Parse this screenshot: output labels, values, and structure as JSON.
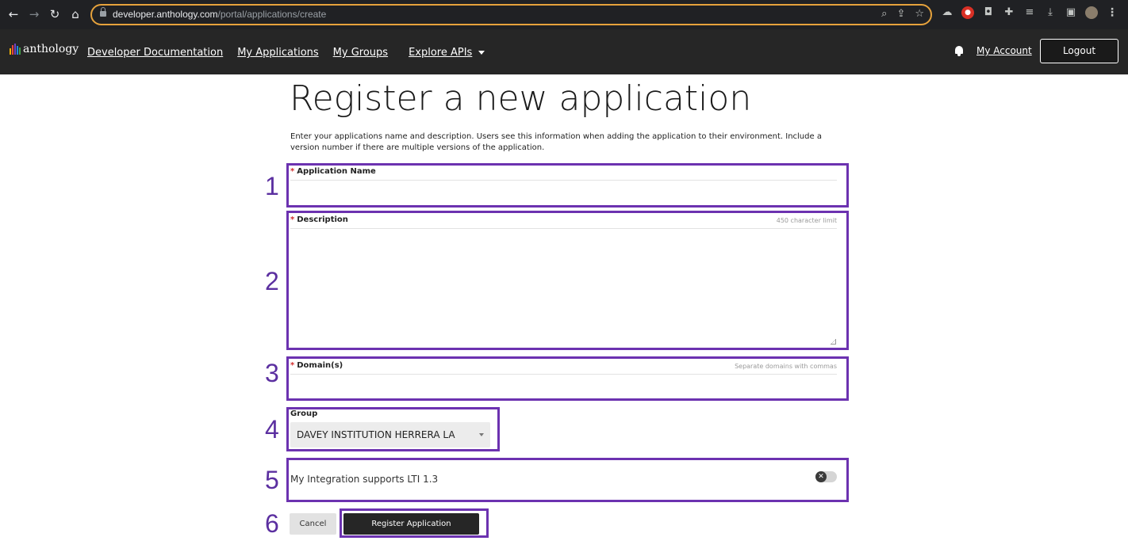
{
  "browser": {
    "url_host": "developer.anthology.com",
    "url_path": "/portal/applications/create",
    "nav_icons": [
      "back-arrow-icon",
      "forward-arrow-icon",
      "reload-icon",
      "home-icon"
    ],
    "omnibox_icons": [
      "zoom-icon",
      "share-icon",
      "bookmark-star-icon"
    ],
    "extension_icons": [
      "extension-1-icon",
      "extension-2-icon",
      "extension-3-icon",
      "puzzle-icon",
      "reading-list-icon",
      "download-icon",
      "side-panel-icon",
      "profile-avatar",
      "kebab-menu-icon"
    ],
    "omnibox_border_color": "#e6a23c"
  },
  "header": {
    "logo_text": "anthology",
    "logo_bar_colors": [
      "#f4b400",
      "#e8453c",
      "#6f42c1",
      "#1e88e5",
      "#43a047"
    ],
    "nav": {
      "docs": "Developer Documentation",
      "apps": "My Applications",
      "groups": "My Groups",
      "explore": "Explore APIs"
    },
    "my_account": "My Account",
    "logout": "Logout"
  },
  "page": {
    "title": "Register a new application",
    "intro": "Enter your applications name and description. Users see this information when adding the application to their environment. Include a version number if there are multiple versions of the application."
  },
  "form": {
    "app_name": {
      "required_mark": "*",
      "label": "Application Name",
      "value": ""
    },
    "description": {
      "required_mark": "*",
      "label": "Description",
      "hint": "450 character limit",
      "value": ""
    },
    "domains": {
      "required_mark": "*",
      "label": "Domain(s)",
      "hint": "Separate domains with commas",
      "value": ""
    },
    "group": {
      "label": "Group",
      "selected": "DAVEY INSTITUTION HERRERA LA"
    },
    "lti": {
      "label": "My Integration supports LTI 1.3",
      "enabled": false,
      "toggle_glyph": "✕"
    },
    "cancel": "Cancel",
    "register": "Register Application"
  },
  "annotations": {
    "color": "#6c32b0",
    "labels": [
      "1",
      "2",
      "3",
      "4",
      "5",
      "6"
    ]
  }
}
